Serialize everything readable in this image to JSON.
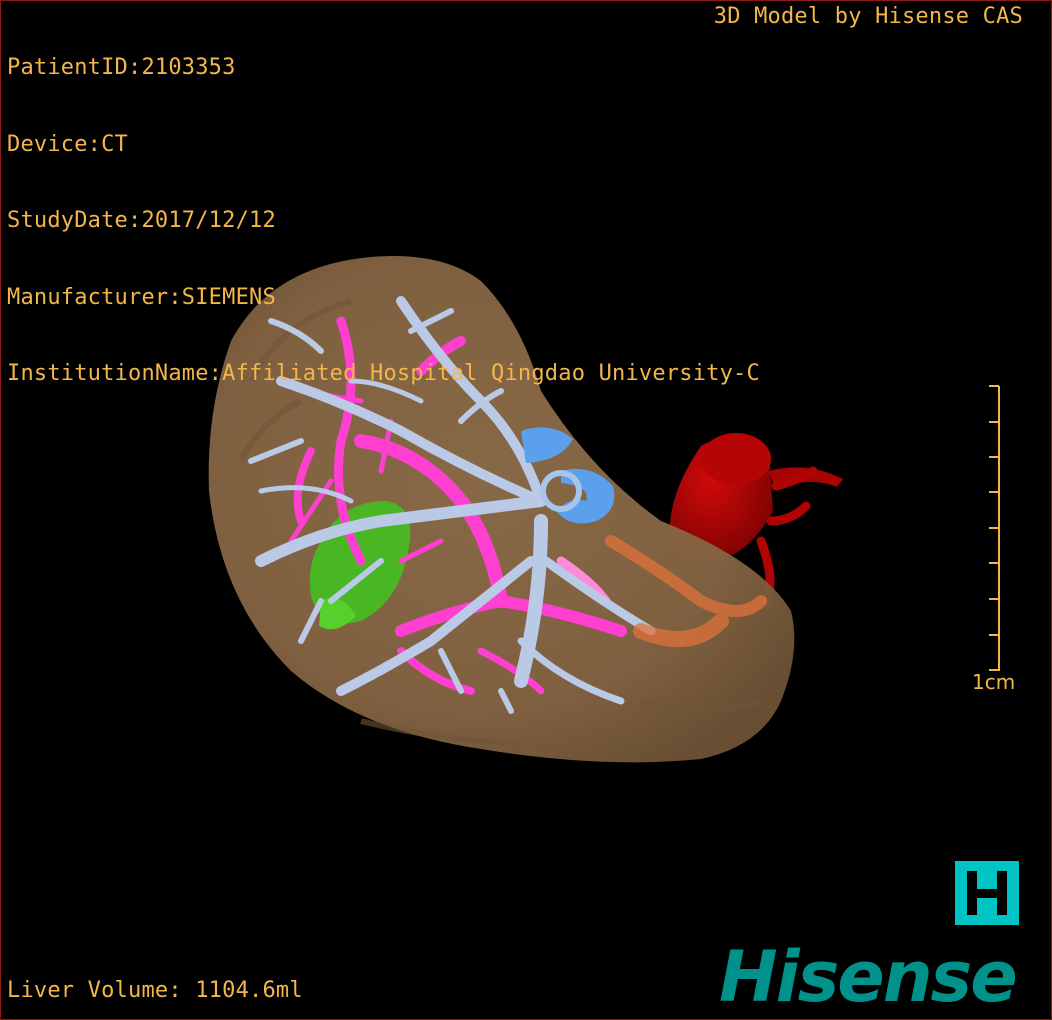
{
  "patient_info": {
    "patient_id": "PatientID:2103353",
    "device": "Device:CT",
    "study_date": "StudyDate:2017/12/12",
    "manufacturer": "Manufacturer:SIEMENS",
    "institution": "InstitutionName:Affiliated Hospital Qingdao University-C"
  },
  "credit": "3D Model by Hisense CAS",
  "scale_bar": {
    "label": "1cm"
  },
  "liver_volume": "Liver Volume: 1104.6ml",
  "logo": {
    "mark": "H",
    "wordmark": "Hisense"
  },
  "colors": {
    "overlay_text": "#f2b64a",
    "liver": "#8c6a48",
    "portal_vein": "#ff3fd0",
    "hepatic_vein": "#b9c9e6",
    "tumor": "#3fc41f",
    "ivc_blue": "#5aa0ec",
    "aorta": "#b40404",
    "brand_teal": "#00918a",
    "logo_box": "#00c4c4"
  }
}
